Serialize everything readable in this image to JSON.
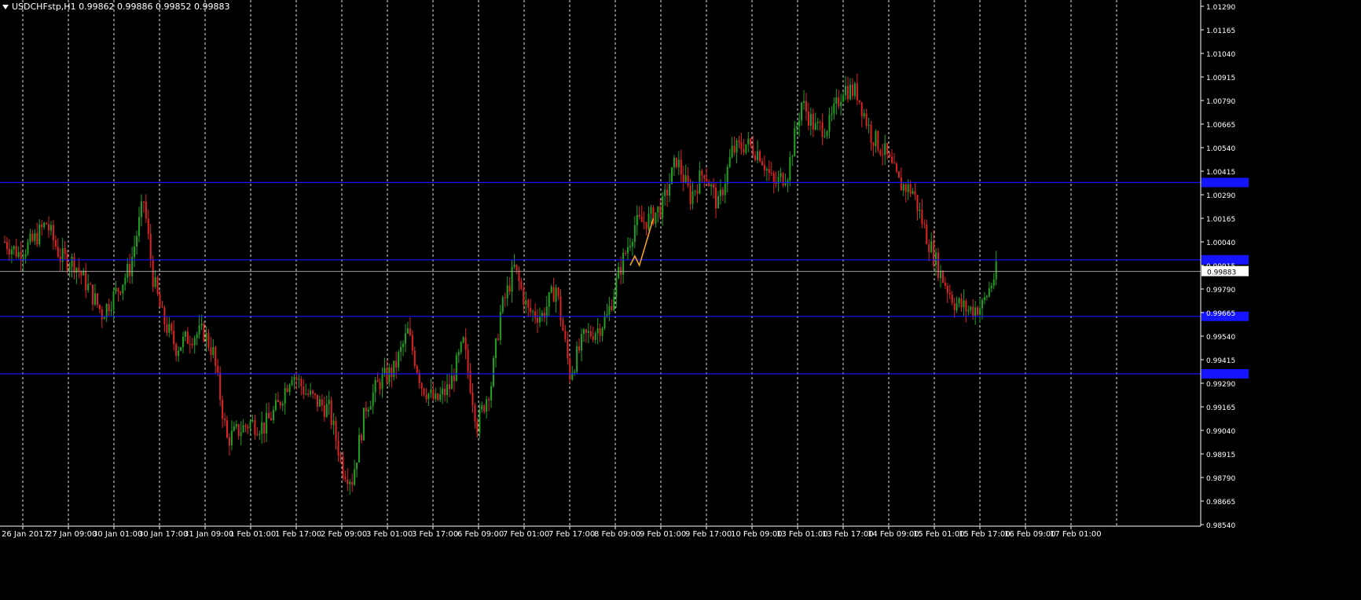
{
  "window": {
    "title": "USDCHFstp,H1  0.99862 0.99886 0.99852 0.99883",
    "menu_icon": "dropdown-triangle-icon"
  },
  "colors": {
    "background": "#000000",
    "axis": "#ffffff",
    "grid": "#ffffff",
    "bull_candle": "#1fa31f",
    "bear_candle": "#e02222",
    "hline": "#1414ff",
    "bid_line": "#a0a0a0",
    "projection": "#ffa51f",
    "hline_tag": "#1414ff"
  },
  "chart_data": {
    "type": "candlestick",
    "symbol": "USDCHFstp",
    "timeframe": "H1",
    "ohlc_header": {
      "open": 0.99862,
      "high": 0.99886,
      "low": 0.99852,
      "close": 0.99883
    },
    "ylim": [
      0.9854,
      1.0129
    ],
    "y_ticks": [
      "1.01290",
      "1.01165",
      "1.01040",
      "1.00915",
      "1.00790",
      "1.00665",
      "1.00540",
      "1.00415",
      "1.00290",
      "1.00165",
      "1.00040",
      "0.99915",
      "0.99790",
      "0.99665",
      "0.99540",
      "0.99415",
      "0.99290",
      "0.99165",
      "0.99040",
      "0.98915",
      "0.98790",
      "0.98665",
      "0.98540"
    ],
    "x_ticks": [
      "26 Jan 2017",
      "27 Jan 09:00",
      "30 Jan 01:00",
      "30 Jan 17:00",
      "31 Jan 09:00",
      "1 Feb 01:00",
      "1 Feb 17:00",
      "2 Feb 09:00",
      "3 Feb 01:00",
      "3 Feb 17:00",
      "6 Feb 09:00",
      "7 Feb 01:00",
      "7 Feb 17:00",
      "8 Feb 09:00",
      "9 Feb 01:00",
      "9 Feb 17:00",
      "10 Feb 09:00",
      "13 Feb 01:00",
      "13 Feb 17:00",
      "14 Feb 09:00",
      "15 Feb 01:00",
      "15 Feb 17:00",
      "16 Feb 09:00",
      "17 Feb 01:00"
    ],
    "current_price_label": "0.99883",
    "current_price": 0.99883,
    "horizontal_levels": [
      1.00355,
      0.99945,
      0.99645,
      0.9934
    ],
    "grid": "vertical dashed",
    "projection_path": [
      {
        "bar": 270,
        "price": 0.99915
      },
      {
        "bar": 272,
        "price": 0.99965
      },
      {
        "bar": 274,
        "price": 0.99915
      },
      {
        "bar": 280,
        "price": 1.00165
      }
    ],
    "close_anchors": [
      [
        0,
        1.0004
      ],
      [
        6,
        0.9998
      ],
      [
        12,
        1.0004
      ],
      [
        18,
        1.0014
      ],
      [
        24,
        0.9996
      ],
      [
        30,
        0.9993
      ],
      [
        36,
        0.998
      ],
      [
        42,
        0.9966
      ],
      [
        48,
        0.9977
      ],
      [
        54,
        0.999
      ],
      [
        60,
        1.0026
      ],
      [
        64,
        0.9985
      ],
      [
        68,
        0.9964
      ],
      [
        74,
        0.9948
      ],
      [
        80,
        0.9954
      ],
      [
        86,
        0.9956
      ],
      [
        90,
        0.9945
      ],
      [
        96,
        0.9899
      ],
      [
        100,
        0.9903
      ],
      [
        106,
        0.9908
      ],
      [
        112,
        0.9906
      ],
      [
        118,
        0.9917
      ],
      [
        124,
        0.9935
      ],
      [
        130,
        0.9924
      ],
      [
        136,
        0.9918
      ],
      [
        140,
        0.9915
      ],
      [
        146,
        0.9884
      ],
      [
        150,
        0.9878
      ],
      [
        156,
        0.9917
      ],
      [
        162,
        0.993
      ],
      [
        168,
        0.9936
      ],
      [
        174,
        0.9956
      ],
      [
        180,
        0.9928
      ],
      [
        186,
        0.9919
      ],
      [
        192,
        0.9927
      ],
      [
        198,
        0.995
      ],
      [
        204,
        0.9907
      ],
      [
        210,
        0.9929
      ],
      [
        214,
        0.9966
      ],
      [
        220,
        0.999
      ],
      [
        226,
        0.9967
      ],
      [
        232,
        0.9965
      ],
      [
        238,
        0.998
      ],
      [
        244,
        0.9934
      ],
      [
        250,
        0.9953
      ],
      [
        256,
        0.9958
      ],
      [
        260,
        0.9964
      ],
      [
        266,
        0.9991
      ],
      [
        272,
        1.0013
      ],
      [
        278,
        1.0016
      ],
      [
        284,
        1.0023
      ],
      [
        290,
        1.0048
      ],
      [
        296,
        1.0028
      ],
      [
        302,
        1.0042
      ],
      [
        308,
        1.0023
      ],
      [
        314,
        1.0052
      ],
      [
        320,
        1.0056
      ],
      [
        326,
        1.0051
      ],
      [
        332,
        1.0034
      ],
      [
        338,
        1.0041
      ],
      [
        344,
        1.0078
      ],
      [
        350,
        1.0064
      ],
      [
        356,
        1.0066
      ],
      [
        362,
        1.0086
      ],
      [
        368,
        1.0083
      ],
      [
        374,
        1.0061
      ],
      [
        380,
        1.0051
      ],
      [
        386,
        1.0035
      ],
      [
        392,
        1.0031
      ],
      [
        398,
        1.0007
      ],
      [
        404,
        0.9987
      ],
      [
        410,
        0.9972
      ],
      [
        416,
        0.9968
      ],
      [
        422,
        0.997
      ],
      [
        428,
        0.99883
      ]
    ]
  }
}
